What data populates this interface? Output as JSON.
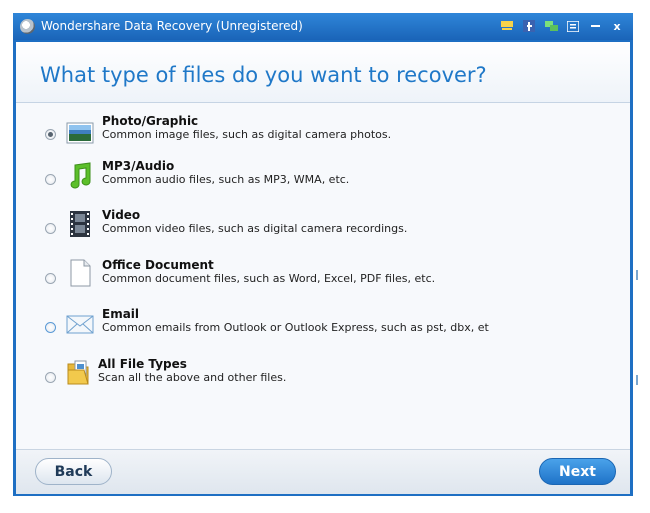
{
  "window": {
    "title": "Wondershare Data Recovery (Unregistered)",
    "titlebar_icons": [
      "cart-icon",
      "facebook-icon",
      "chat-icon",
      "menu-icon",
      "minimize-icon",
      "close-icon"
    ],
    "close_glyph": "x"
  },
  "page": {
    "title": "What type of files do you want to recover?"
  },
  "options": [
    {
      "label": "Photo/Graphic",
      "description": "Common image files, such as digital camera photos.",
      "icon": "photo-icon",
      "selected": true
    },
    {
      "label": "MP3/Audio",
      "description": "Common audio files, such as MP3, WMA, etc.",
      "icon": "music-note-icon",
      "selected": false
    },
    {
      "label": "Video",
      "description": "Common video files, such as digital camera recordings.",
      "icon": "film-strip-icon",
      "selected": false
    },
    {
      "label": "Office Document",
      "description": "Common document files, such as Word, Excel, PDF files, etc.",
      "icon": "document-icon",
      "selected": false
    },
    {
      "label": "Email",
      "description": "Common emails from Outlook or Outlook Express, such as pst, dbx, et",
      "icon": "envelope-icon",
      "selected": false
    },
    {
      "label": "All File Types",
      "description": "Scan all the above and other files.",
      "icon": "folder-icon",
      "selected": false
    }
  ],
  "footer": {
    "back_label": "Back",
    "next_label": "Next"
  },
  "colors": {
    "title_accent": "#1f78c8",
    "titlebar": "#1e6fc3",
    "next_button": "#1f73c8"
  }
}
